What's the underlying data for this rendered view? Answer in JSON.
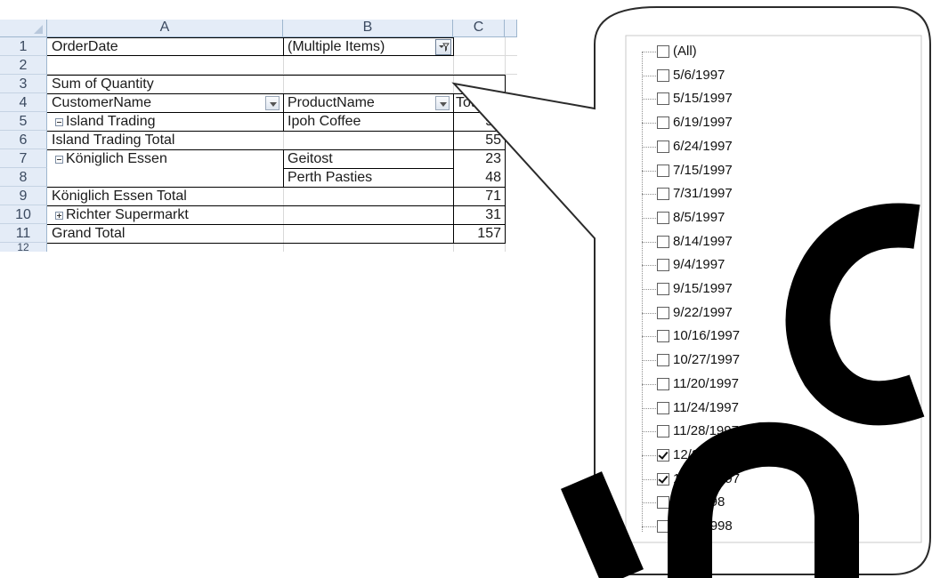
{
  "sheet": {
    "columns": [
      "A",
      "B",
      "C",
      "12"
    ],
    "rows": [
      "1",
      "2",
      "3",
      "4",
      "5",
      "6",
      "7",
      "8",
      "9",
      "10",
      "11"
    ],
    "cells": {
      "a1": "OrderDate",
      "b1": "(Multiple Items)",
      "a3": "Sum of Quantity",
      "a4": "CustomerName",
      "b4": "ProductName",
      "c4": "Total",
      "a5": "Island Trading",
      "b5": "Ipoh Coffee",
      "c5": "55",
      "a6": "Island Trading Total",
      "c6": "55",
      "a7": "Königlich Essen",
      "b7": "Geitost",
      "c7": "23",
      "b8": "Perth Pasties",
      "c8": "48",
      "a9": "Königlich Essen Total",
      "c9": "71",
      "a10": "Richter Supermarkt",
      "c10": "31",
      "a11": "Grand Total",
      "c11": "157"
    }
  },
  "filter_list": {
    "items": [
      {
        "label": "(All)",
        "checked": false
      },
      {
        "label": "5/6/1997",
        "checked": false
      },
      {
        "label": "5/15/1997",
        "checked": false
      },
      {
        "label": "6/19/1997",
        "checked": false
      },
      {
        "label": "6/24/1997",
        "checked": false
      },
      {
        "label": "7/15/1997",
        "checked": false
      },
      {
        "label": "7/31/1997",
        "checked": false
      },
      {
        "label": "8/5/1997",
        "checked": false
      },
      {
        "label": "8/14/1997",
        "checked": false
      },
      {
        "label": "9/4/1997",
        "checked": false
      },
      {
        "label": "9/15/1997",
        "checked": false
      },
      {
        "label": "9/22/1997",
        "checked": false
      },
      {
        "label": "10/16/1997",
        "checked": false
      },
      {
        "label": "10/27/1997",
        "checked": false
      },
      {
        "label": "11/20/1997",
        "checked": false
      },
      {
        "label": "11/24/1997",
        "checked": false
      },
      {
        "label": "11/28/1997",
        "checked": false
      },
      {
        "label": "12/23/1997",
        "checked": true
      },
      {
        "label": "12/26/1997",
        "checked": true
      },
      {
        "label": "1/6/1998",
        "checked": false
      },
      {
        "label": "1/23/1998",
        "checked": false
      }
    ]
  },
  "colors": {
    "header_bg": "#e4ecf7",
    "grid": "#d9d9d9",
    "watermark": "#000000"
  },
  "icons": [
    "filter-icon",
    "dropdown-arrow-icon",
    "collapse-icon",
    "expand-icon",
    "checkbox-icon",
    "sheet-corner-icon"
  ]
}
